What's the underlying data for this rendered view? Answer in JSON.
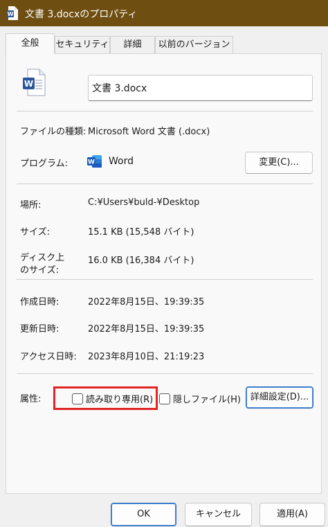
{
  "window": {
    "title": "文書 3.docxのプロパティ",
    "title_icon": "word-doc-icon",
    "titlebar_color": "#6f4e11"
  },
  "tabs": [
    {
      "label": "全般",
      "active": true
    },
    {
      "label": "セキュリティ",
      "active": false
    },
    {
      "label": "詳細",
      "active": false
    },
    {
      "label": "以前のバージョン",
      "active": false
    }
  ],
  "general": {
    "file_icon": "word-document-icon",
    "file_name": "文書 3.docx",
    "type_label": "ファイルの種類:",
    "type_value": "Microsoft Word 文書 (.docx)",
    "program_label": "プログラム:",
    "program_icon": "word-app-icon",
    "program_value": "Word",
    "change_button": "変更(C)...",
    "location_label": "場所:",
    "location_value": "C:¥Users¥buld-¥Desktop",
    "size_label": "サイズ:",
    "size_value": "15.1 KB (15,548 バイト)",
    "disk_size_label_1": "ディスク上",
    "disk_size_label_2": "のサイズ:",
    "disk_size_value": "16.0 KB (16,384 バイト)",
    "created_label": "作成日時:",
    "created_value": "2022年8月15日、19:39:35",
    "modified_label": "更新日時:",
    "modified_value": "2022年8月15日、19:39:35",
    "accessed_label": "アクセス日時:",
    "accessed_value": "2023年8月10日、21:19:23",
    "attributes_label": "属性:",
    "readonly_label": "読み取り専用(R)",
    "readonly_checked": false,
    "hidden_label": "隠しファイル(H)",
    "hidden_checked": false,
    "advanced_button": "詳細設定(D)...",
    "highlight_color": "#e02424"
  },
  "footer": {
    "ok": "OK",
    "cancel": "キャンセル",
    "apply": "適用(A)"
  }
}
